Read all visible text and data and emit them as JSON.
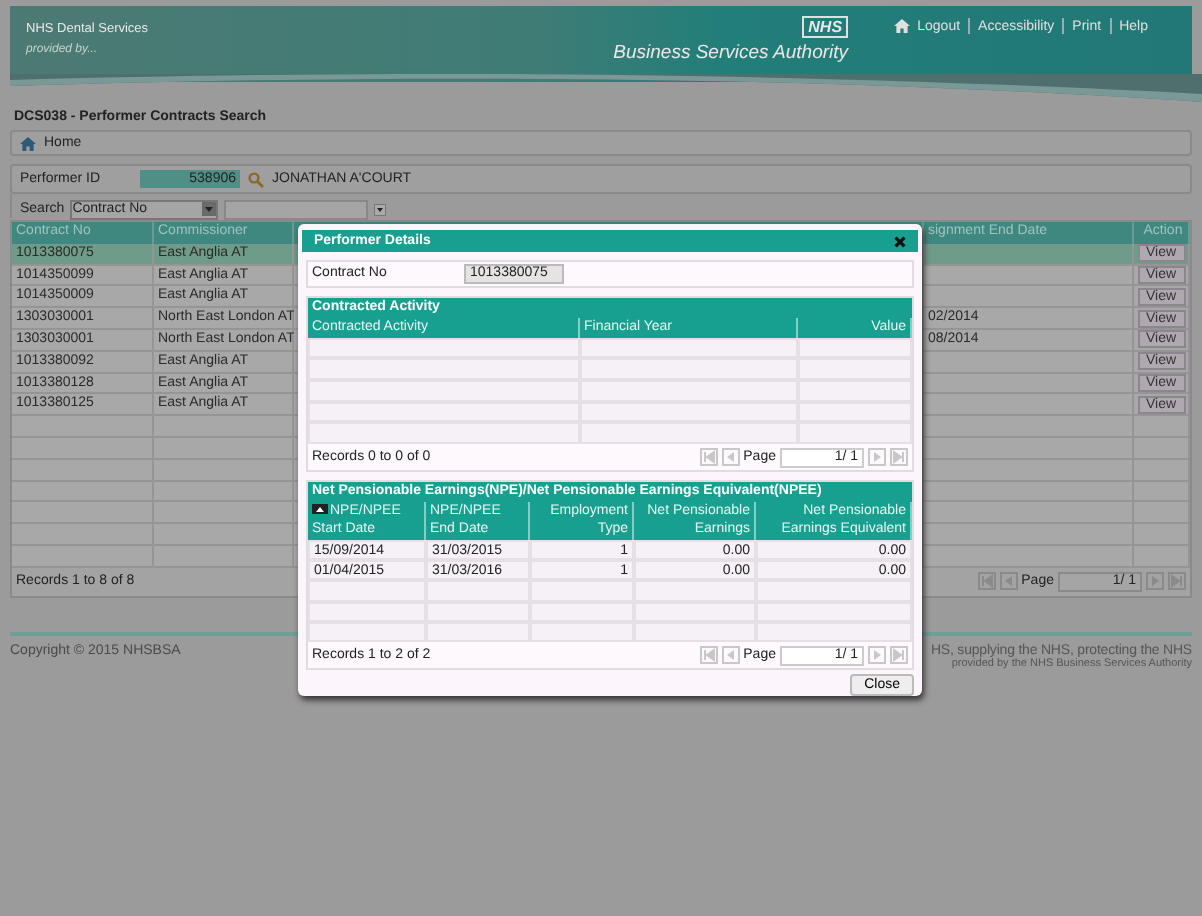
{
  "header": {
    "org": "NHS Dental Services",
    "tagline": "provided by...",
    "logo": "NHS",
    "authority": "Business Services Authority",
    "links": [
      "Logout",
      "Accessibility",
      "Print",
      "Help"
    ]
  },
  "page_title": "DCS038 - Performer Contracts Search",
  "breadcrumb": "Home",
  "performer": {
    "label": "Performer ID",
    "id": "538906",
    "name": "JONATHAN A'COURT"
  },
  "search": {
    "label": "Search",
    "field": "Contract No"
  },
  "table": {
    "columns": [
      "Contract No",
      "Commissioner",
      "signment End Date",
      "Action"
    ],
    "rows": [
      {
        "contract_no": "1013380075",
        "commissioner": "East Anglia AT",
        "action": "View",
        "selected": true
      },
      {
        "contract_no": "1014350099",
        "commissioner": "East Anglia AT",
        "action": "View",
        "selected": false
      },
      {
        "contract_no": "1014350009",
        "commissioner": "East Anglia AT",
        "action": "View",
        "selected": false
      },
      {
        "contract_no": "1303030001",
        "commissioner": "North East London AT",
        "end_date": "02/2014",
        "action": "View",
        "selected": false
      },
      {
        "contract_no": "1303030001",
        "commissioner": "North East London AT",
        "end_date": "08/2014",
        "action": "View",
        "selected": false
      },
      {
        "contract_no": "1013380092",
        "commissioner": "East Anglia AT",
        "action": "View",
        "selected": false
      },
      {
        "contract_no": "1013380128",
        "commissioner": "East Anglia AT",
        "action": "View",
        "selected": false
      },
      {
        "contract_no": "1013380125",
        "commissioner": "East Anglia AT",
        "action": "View",
        "selected": false
      }
    ],
    "records": "Records 1 to 8 of 8",
    "pager": {
      "label": "Page",
      "value": "1/ 1"
    }
  },
  "footer": {
    "copyright": "Copyright © 2015 NHSBSA",
    "slogan": "HS, supplying the NHS, protecting the NHS",
    "credit": "provided by the NHS Business Services Authority"
  },
  "dialog": {
    "title": "Performer Details",
    "contract_label": "Contract No",
    "contract_no": "1013380075",
    "activity": {
      "title": "Contracted Activity",
      "columns": [
        "Contracted Activity",
        "Financial Year",
        "Value"
      ],
      "records": "Records 0 to 0 of 0",
      "pager": {
        "label": "Page",
        "value": "1/ 1"
      }
    },
    "npe": {
      "title": "Net Pensionable Earnings(NPE)/Net Pensionable Earnings Equivalent(NPEE)",
      "columns": [
        "NPE/NPEE Start Date",
        "NPE/NPEE End Date",
        "Employment Type",
        "Net Pensionable Earnings",
        "Net Pensionable Earnings Equivalent"
      ],
      "rows": [
        {
          "cells": [
            "15/09/2014",
            "31/03/2015",
            "1",
            "0.00",
            "0.00"
          ]
        },
        {
          "cells": [
            "01/04/2015",
            "31/03/2016",
            "1",
            "0.00",
            "0.00"
          ]
        }
      ],
      "records": "Records 1 to 2 of 2",
      "pager": {
        "label": "Page",
        "value": "1/ 1"
      }
    },
    "close": "Close"
  }
}
